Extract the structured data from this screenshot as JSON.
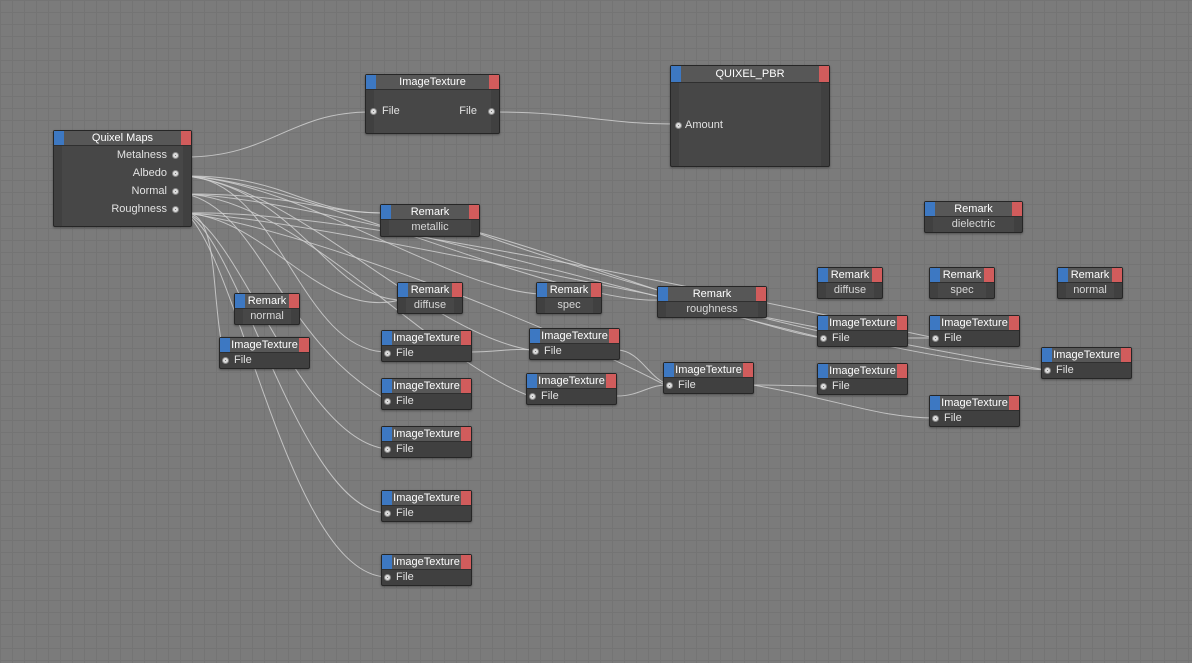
{
  "colors": {
    "background": "#7b7b7b",
    "node_body": "#404040",
    "node_header": "#575757",
    "input_cap": "#3d78c2",
    "output_cap": "#d15c5c",
    "wire": "#d0d0d0"
  },
  "nodes": {
    "quixel_maps": {
      "title": "Quixel Maps",
      "outputs": [
        "Metalness",
        "Albedo",
        "Normal",
        "Roughness"
      ]
    },
    "image_texture_top": {
      "title": "ImageTexture",
      "input_label": "File",
      "output_label": "File"
    },
    "quixel_pbr": {
      "title": "QUIXEL_PBR",
      "input_label": "Amount"
    },
    "remark_metallic": {
      "title": "Remark",
      "subtitle": "metallic"
    },
    "remark_dielectric": {
      "title": "Remark",
      "subtitle": "dielectric"
    },
    "remark_normal_left": {
      "title": "Remark",
      "subtitle": "normal"
    },
    "remark_diffuse_left": {
      "title": "Remark",
      "subtitle": "diffuse"
    },
    "remark_spec_mid": {
      "title": "Remark",
      "subtitle": "spec"
    },
    "remark_roughness": {
      "title": "Remark",
      "subtitle": "roughness"
    },
    "remark_diffuse_right": {
      "title": "Remark",
      "subtitle": "diffuse"
    },
    "remark_spec_right": {
      "title": "Remark",
      "subtitle": "spec"
    },
    "remark_normal_right": {
      "title": "Remark",
      "subtitle": "normal"
    },
    "image_texture_nodes": {
      "title": "ImageTexture",
      "input_label": "File"
    }
  }
}
